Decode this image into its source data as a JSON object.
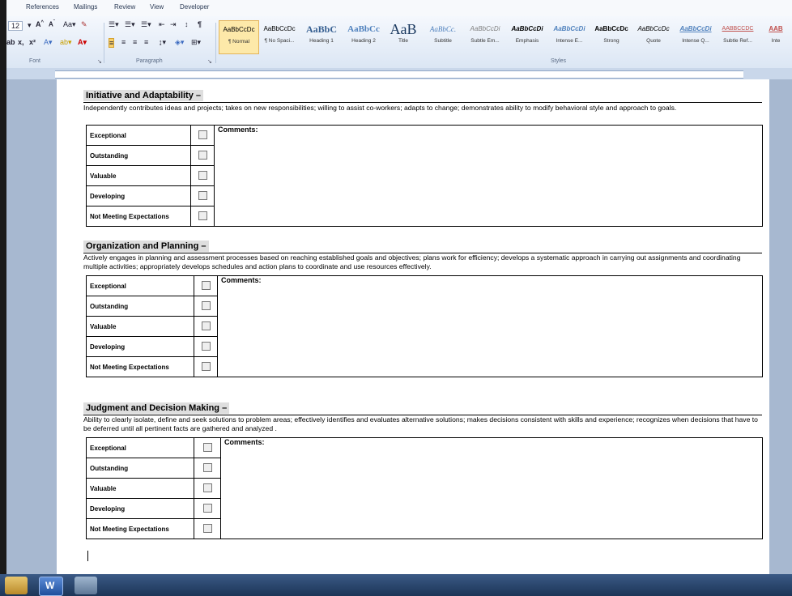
{
  "ribbon": {
    "tabs": [
      "References",
      "Mailings",
      "Review",
      "View",
      "Developer"
    ],
    "font_size": "12",
    "group_labels": {
      "font": "Font",
      "paragraph": "Paragraph",
      "styles": "Styles"
    },
    "styles": [
      {
        "preview": "AaBbCcDc",
        "name": "¶ Normal"
      },
      {
        "preview": "AaBbCcDc",
        "name": "¶ No Spaci..."
      },
      {
        "preview": "AaBbC",
        "name": "Heading 1"
      },
      {
        "preview": "AaBbCc",
        "name": "Heading 2"
      },
      {
        "preview": "AaB",
        "name": "Title"
      },
      {
        "preview": "AaBbCc.",
        "name": "Subtitle"
      },
      {
        "preview": "AaBbCcDi",
        "name": "Subtle Em..."
      },
      {
        "preview": "AaBbCcDi",
        "name": "Emphasis"
      },
      {
        "preview": "AaBbCcDi",
        "name": "Intense E..."
      },
      {
        "preview": "AaBbCcDc",
        "name": "Strong"
      },
      {
        "preview": "AaBbCcDc",
        "name": "Quote"
      },
      {
        "preview": "AaBbCcDi",
        "name": "Intense Q..."
      },
      {
        "preview": "AABBCCDC",
        "name": "Subtle Ref..."
      },
      {
        "preview": "AAB",
        "name": "Inte"
      }
    ]
  },
  "document": {
    "comments_label": "Comments:",
    "ratings": [
      "Exceptional",
      "Outstanding",
      "Valuable",
      "Developing",
      "Not Meeting Expectations"
    ],
    "sections": [
      {
        "title": "Initiative and Adaptability –",
        "description": "Independently contributes ideas and projects; takes on new responsibilities; willing to assist co-workers; adapts to change; demonstrates ability to modify behavioral style and approach to goals."
      },
      {
        "title": "Organization and Planning –",
        "description": "Actively engages in planning and assessment processes based on reaching established goals and objectives; plans work for efficiency; develops a systematic approach in carrying out assignments and coordinating multiple activities; appropriately develops schedules and action plans to coordinate and use resources effectively."
      },
      {
        "title": "Judgment and Decision Making –",
        "description": "Ability to clearly isolate, define and seek solutions to problem areas; effectively identifies and evaluates alternative solutions; makes decisions consistent with skills and experience; recognizes when decisions that have to be deferred until all pertinent facts are gathered and analyzed ."
      }
    ]
  }
}
